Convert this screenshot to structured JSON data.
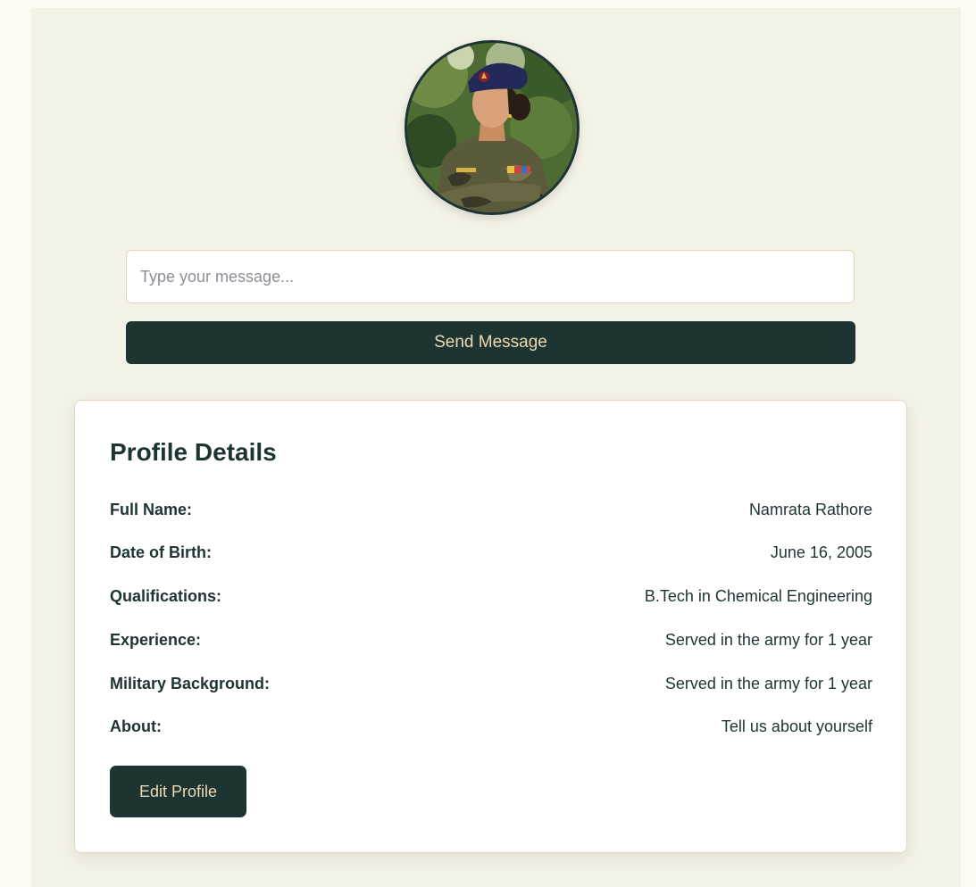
{
  "message_box": {
    "placeholder": "Type your message...",
    "value": "",
    "send_label": "Send Message"
  },
  "profile": {
    "title": "Profile Details",
    "fields": [
      {
        "label": "Full Name:",
        "value": "Namrata Rathore"
      },
      {
        "label": "Date of Birth:",
        "value": "June 16, 2005"
      },
      {
        "label": "Qualifications:",
        "value": "B.Tech in Chemical Engineering"
      },
      {
        "label": "Experience:",
        "value": "Served in the army for 1 year"
      },
      {
        "label": "Military Background:",
        "value": "Served in the army for 1 year"
      },
      {
        "label": "About:",
        "value": "Tell us about yourself"
      }
    ],
    "edit_label": "Edit Profile"
  },
  "colors": {
    "page_background": "#fdfaf3",
    "panel_background": "#f3f2e6",
    "primary": "#1e3432",
    "button_text": "#ecd9b0",
    "border": "#e3d3bf"
  },
  "icons": {
    "avatar": "profile-photo"
  }
}
